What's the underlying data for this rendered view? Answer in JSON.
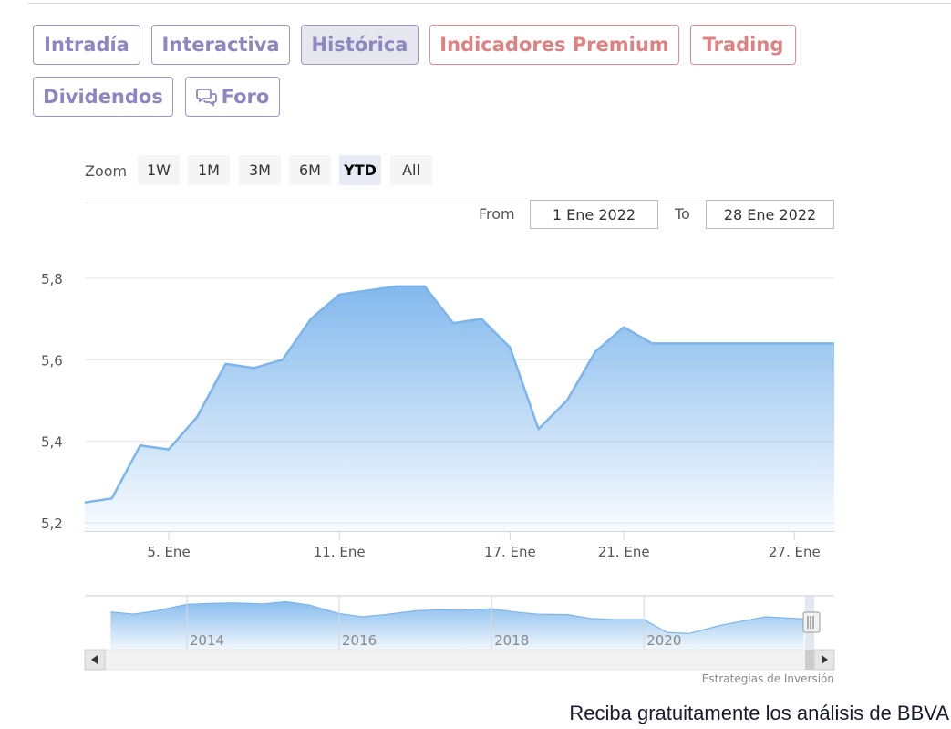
{
  "tabs": [
    {
      "label": "Intradía"
    },
    {
      "label": "Interactiva"
    },
    {
      "label": "Histórica"
    },
    {
      "label": "Indicadores Premium"
    },
    {
      "label": "Trading"
    },
    {
      "label": "Dividendos"
    },
    {
      "label": "Foro"
    }
  ],
  "zoom": {
    "label": "Zoom",
    "buttons": [
      "1W",
      "1M",
      "3M",
      "6M",
      "YTD",
      "All"
    ],
    "selected": "YTD"
  },
  "range": {
    "from_label": "From",
    "from_value": "1 Ene 2022",
    "to_label": "To",
    "to_value": "28 Ene 2022"
  },
  "colors": {
    "tab_purple": "#8c87c0",
    "tab_red": "#dd8282",
    "series": "#7cb5ec"
  },
  "chart_data": {
    "type": "area",
    "x_tick_labels": [
      "5. Ene",
      "11. Ene",
      "17. Ene",
      "21. Ene",
      "27. Ene"
    ],
    "x_tick_days": [
      5,
      11,
      17,
      21,
      27
    ],
    "xlim": [
      2.05,
      28.4
    ],
    "ylim": [
      5.18,
      5.82
    ],
    "y_ticks": [
      5.2,
      5.4,
      5.6,
      5.8
    ],
    "y_tick_labels": [
      "5,2",
      "5,4",
      "5,6",
      "5,8"
    ],
    "grid": true,
    "x": [
      2.05,
      3,
      4,
      5,
      6,
      7,
      8,
      9,
      10,
      11,
      12,
      13,
      14,
      15,
      16,
      17,
      18,
      19,
      20,
      21,
      22,
      23,
      24,
      25,
      26,
      27,
      28,
      28.4
    ],
    "y": [
      5.25,
      5.26,
      5.39,
      5.38,
      5.46,
      5.59,
      5.58,
      5.6,
      5.7,
      5.76,
      5.77,
      5.78,
      5.78,
      5.69,
      5.7,
      5.63,
      5.43,
      5.5,
      5.62,
      5.68,
      5.64,
      5.64,
      5.64,
      5.64,
      5.64,
      5.64,
      5.64,
      5.64
    ],
    "navigator": {
      "tick_labels": [
        "2014",
        "2016",
        "2018",
        "2020"
      ],
      "x": [
        2013.0,
        2013.3,
        2013.6,
        2014.0,
        2014.3,
        2014.6,
        2015.0,
        2015.3,
        2015.6,
        2016.0,
        2016.3,
        2016.6,
        2017.0,
        2017.3,
        2017.6,
        2018.0,
        2018.3,
        2018.6,
        2019.0,
        2019.3,
        2019.6,
        2020.0,
        2020.3,
        2020.6,
        2021.0,
        2021.3,
        2021.6,
        2022.0,
        2022.1
      ],
      "y": [
        7.0,
        6.6,
        7.2,
        8.4,
        8.6,
        8.7,
        8.5,
        8.9,
        8.3,
        6.7,
        6.1,
        6.5,
        7.2,
        7.4,
        7.3,
        7.6,
        7.0,
        6.6,
        6.5,
        5.8,
        5.6,
        5.6,
        3.2,
        3.0,
        4.5,
        5.3,
        6.1,
        5.8,
        5.7
      ]
    }
  },
  "credit": "Estrategias de Inversión",
  "promo": "Reciba gratuitamente los análisis de BBVA"
}
